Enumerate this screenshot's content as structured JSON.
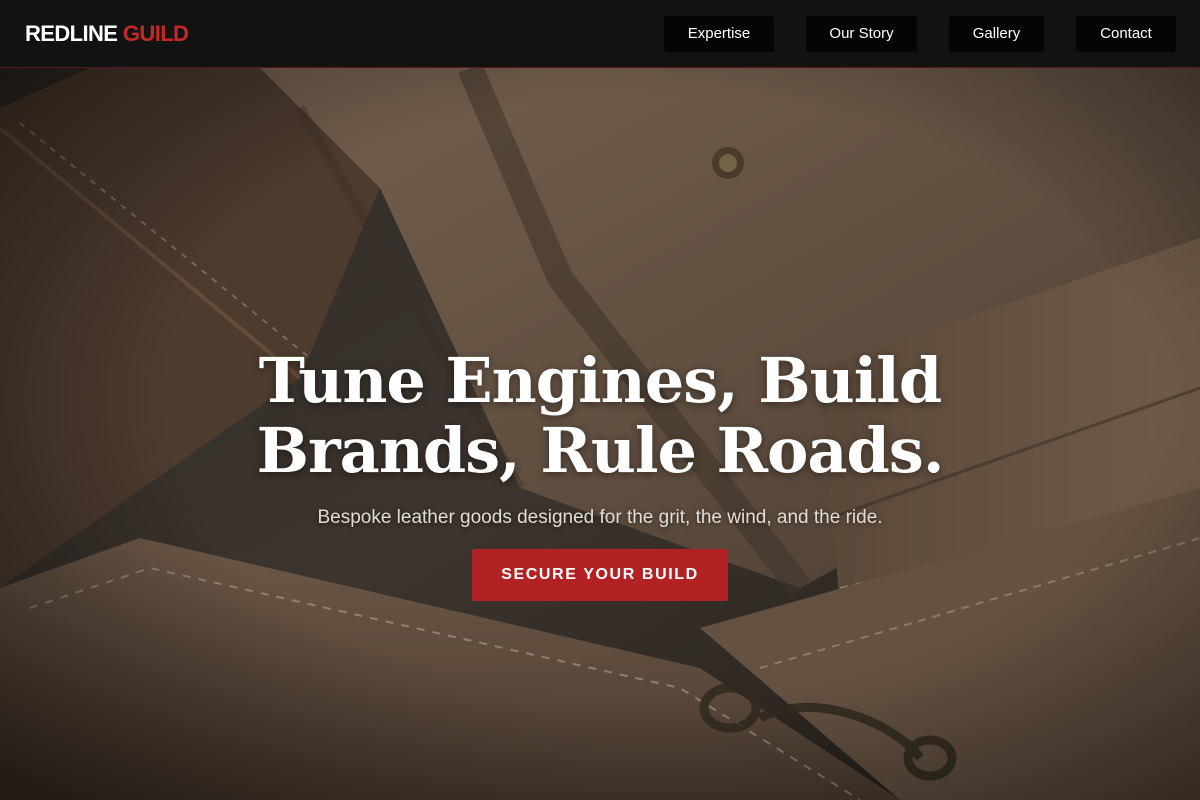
{
  "brand": {
    "name_primary": "REDLINE",
    "name_accent": "GUILD"
  },
  "nav": {
    "items": [
      {
        "label": "Expertise"
      },
      {
        "label": "Our Story"
      },
      {
        "label": "Gallery"
      },
      {
        "label": "Contact"
      }
    ]
  },
  "hero": {
    "title": "Tune Engines, Build Brands, Rule Roads.",
    "subtitle": "Bespoke leather goods designed for the grit, the wind, and the ride.",
    "cta_label": "SECURE YOUR BUILD",
    "background_image": "leather-goods-photo"
  },
  "colors": {
    "header_bg": "#121212",
    "accent": "#c62828",
    "cta_bg": "#b22222",
    "nav_button_bg": "#050505",
    "text_light": "#ffffff"
  }
}
